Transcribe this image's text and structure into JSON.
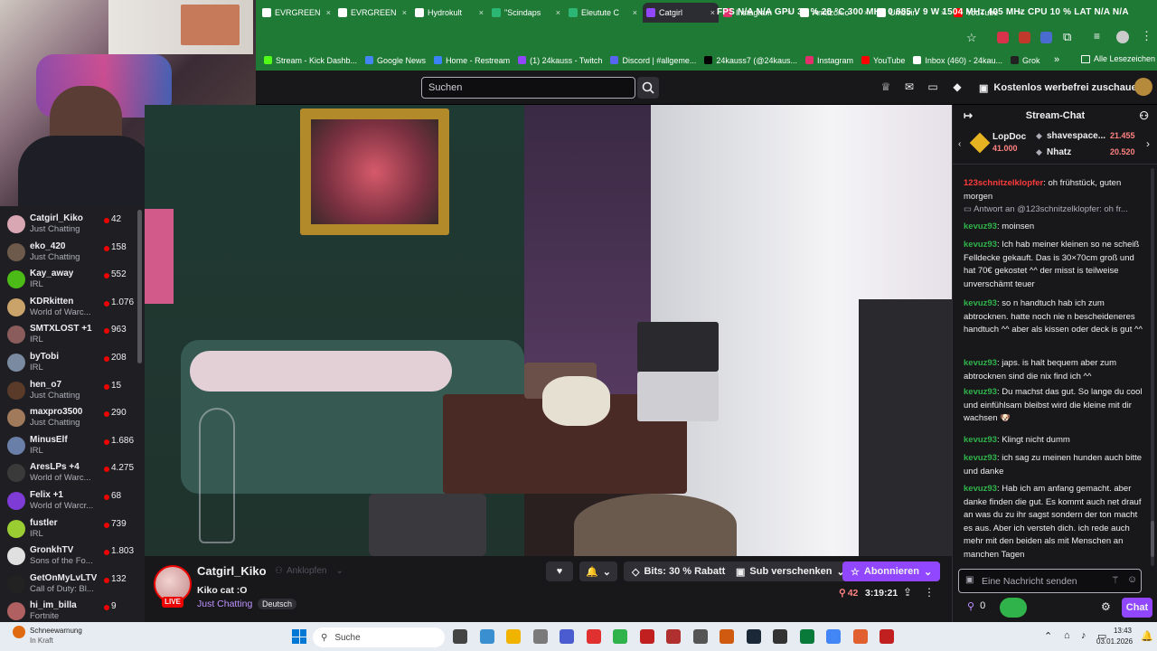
{
  "browser": {
    "tabs": [
      {
        "label": "EVRGREEN",
        "color": "#ffffff"
      },
      {
        "label": "EVRGREEN",
        "color": "#ffffff"
      },
      {
        "label": "Hydrokult",
        "color": "#ffffff"
      },
      {
        "label": "\"Scindaps",
        "color": "#2bb673"
      },
      {
        "label": "Eleutute C",
        "color": "#2bb673"
      },
      {
        "label": "Catgirl",
        "color": "#9147ff"
      },
      {
        "label": "Instagram",
        "color": "#e1306c"
      },
      {
        "label": "Amazon.c",
        "color": "#ffffff"
      },
      {
        "label": "Umzein",
        "color": "#ffffff"
      },
      {
        "label": "YouTube",
        "color": "#ff0000"
      }
    ],
    "overlay_text": "FPS N/A N/A   GPU 35 % 28 °C 300 MHz 0.885 V 9 W 1504 MHz 405 MHz   CPU 10 %   LAT N/A N/A",
    "bookmarks": [
      {
        "label": "Stream - Kick Dashb...",
        "color": "#53fc18"
      },
      {
        "label": "Google News",
        "color": "#4285f4"
      },
      {
        "label": "Home - Restream",
        "color": "#3b82f6"
      },
      {
        "label": "(1) 24kauss - Twitch",
        "color": "#9147ff"
      },
      {
        "label": "Discord | #allgeme...",
        "color": "#5865f2"
      },
      {
        "label": "24kauss7 (@24kaus...",
        "color": "#000000"
      },
      {
        "label": "Instagram",
        "color": "#e1306c"
      },
      {
        "label": "YouTube",
        "color": "#ff0000"
      },
      {
        "label": "Inbox (460) - 24kau...",
        "color": "#ffffff"
      },
      {
        "label": "Grok",
        "color": "#222222"
      }
    ],
    "bookmarks_more": "»",
    "all_bookmarks": "Alle Lesezeichen"
  },
  "twitch_nav": {
    "search_placeholder": "Suchen",
    "promo_label": "Kostenlos werbefrei zuschauen"
  },
  "sidebar": {
    "channels": [
      {
        "name": "Catgirl_Kiko",
        "category": "Just Chatting",
        "viewers": "42",
        "color": "#d9a7b3"
      },
      {
        "name": "eko_420",
        "category": "Just Chatting",
        "viewers": "158",
        "color": "#6d5a4a"
      },
      {
        "name": "Kay_away",
        "category": "IRL",
        "viewers": "552",
        "color": "#4cbb17"
      },
      {
        "name": "KDRkitten",
        "category": "World of Warc...",
        "viewers": "1.076",
        "color": "#c9a36a"
      },
      {
        "name": "SMTXLOST +1",
        "category": "IRL",
        "viewers": "963",
        "color": "#8a5c5c"
      },
      {
        "name": "byTobi",
        "category": "IRL",
        "viewers": "208",
        "color": "#7a8aa0"
      },
      {
        "name": "hen_o7",
        "category": "Just Chatting",
        "viewers": "15",
        "color": "#5a3b2a"
      },
      {
        "name": "maxpro3500",
        "category": "Just Chatting",
        "viewers": "290",
        "color": "#a07a5a"
      },
      {
        "name": "MinusElf",
        "category": "IRL",
        "viewers": "1.686",
        "color": "#6a7fa8"
      },
      {
        "name": "AresLPs +4",
        "category": "World of Warc...",
        "viewers": "4.275",
        "color": "#3a3a3a"
      },
      {
        "name": "Felix +1",
        "category": "World of Warcr...",
        "viewers": "68",
        "color": "#7e3bd6"
      },
      {
        "name": "fustler",
        "category": "IRL",
        "viewers": "739",
        "color": "#9acd32"
      },
      {
        "name": "GronkhTV",
        "category": "Sons of the Fo...",
        "viewers": "1.803",
        "color": "#e0e0e0"
      },
      {
        "name": "GetOnMyLvLTV",
        "category": "Call of Duty: Bl...",
        "viewers": "132",
        "color": "#222222"
      },
      {
        "name": "hi_im_billa",
        "category": "Fortnite",
        "viewers": "9",
        "color": "#b06060"
      }
    ]
  },
  "stream": {
    "channel": "Catgirl_Kiko",
    "follow_label": "Anklopfen",
    "title": "Kiko cat :O",
    "category": "Just Chatting",
    "language": "Deutsch",
    "live_badge": "LIVE",
    "bits_label": "Bits: 30 % Rabatt",
    "gift_label": "Sub verschenken",
    "subscribe_label": "Abonnieren",
    "viewers": "42",
    "uptime": "3:19:21"
  },
  "chat": {
    "header": "Stream-Chat",
    "leaderboard": [
      {
        "name": "LopDoc",
        "amount": "41.000"
      },
      {
        "name": "shavespace...",
        "amount": "21.455"
      },
      {
        "name": "Nhatz",
        "amount": "20.520"
      }
    ],
    "messages": [
      {
        "user": "123schnitzelklopfer",
        "color": "#ff3b3b",
        "text": "oh frühstück, guten morgen"
      },
      {
        "user": "",
        "color": "#adadb8",
        "text": "Antwort an @123schnitzelklopfer: oh fr..."
      },
      {
        "user": "kevuz93",
        "color": "#2fb34a",
        "text": "moinsen"
      },
      {
        "user": "kevuz93",
        "color": "#2fb34a",
        "text": "Ich hab meiner kleinen so ne scheiß Felldecke gekauft. Das is 30×70cm groß und hat 70€ gekostet ^^ der misst is teilweise unverschämt teuer"
      },
      {
        "user": "kevuz93",
        "color": "#2fb34a",
        "text": "so n handtuch hab ich zum abtrocknen. hatte noch nie n bescheideneres handtuch ^^ aber als kissen oder deck is gut ^^"
      },
      {
        "user": "kevuz93",
        "color": "#2fb34a",
        "text": "japs. is halt bequem aber zum abtrocknen sind die nix find ich ^^"
      },
      {
        "user": "kevuz93",
        "color": "#2fb34a",
        "text": "Du machst das gut. So lange du cool und einfühlsam bleibst wird die kleine mit dir wachsen 🐶"
      },
      {
        "user": "kevuz93",
        "color": "#2fb34a",
        "text": "Klingt nicht dumm"
      },
      {
        "user": "kevuz93",
        "color": "#2fb34a",
        "text": "ich sag zu meinen hunden auch bitte und danke"
      },
      {
        "user": "kevuz93",
        "color": "#2fb34a",
        "text": "Hab ich am anfang gemacht. aber danke finden die gut. Es kommt auch net drauf an was du zu ihr sagst sondern der ton macht es aus. Aber ich versteh dich. ich rede auch mehr mit den beiden als mit Menschen an manchen Tagen"
      }
    ],
    "input_placeholder": "Eine Nachricht senden",
    "points": "0",
    "send_label": "Chat"
  },
  "taskbar": {
    "weather_title": "Schneewarnung",
    "weather_sub": "In Kraft",
    "search_placeholder": "Suche",
    "time": "13:43",
    "date": "03.01.2026"
  }
}
